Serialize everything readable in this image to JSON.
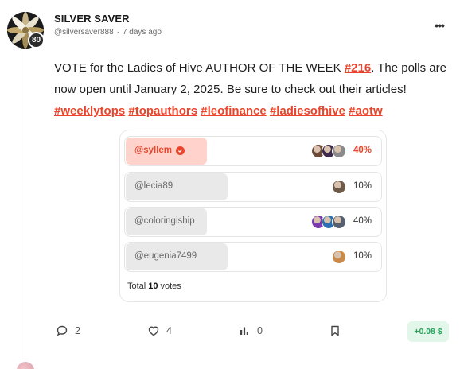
{
  "author": {
    "name": "SILVER SAVER",
    "handle": "@silversaver888",
    "separator": "·",
    "time_ago": "7 days ago",
    "reputation": "80"
  },
  "more_label": "•••",
  "post": {
    "text_intro": "VOTE for the Ladies of Hive AUTHOR OF THE WEEK ",
    "issue_tag": "#216",
    "text_rest": ". The polls are now open until January 2, 2025. Be sure to check out their articles! ",
    "hashtags": [
      "#weeklytops",
      "#topauthors",
      "#leofinance",
      "#ladiesofhive",
      "#aotw"
    ]
  },
  "poll": {
    "options": [
      {
        "label": "@syllem",
        "percent": "40%",
        "fill_fraction": 0.4,
        "winner": true,
        "voters": [
          "#6b4a3a",
          "#3d2a4d",
          "#8a8a8a"
        ]
      },
      {
        "label": "@lecia89",
        "percent": "10%",
        "fill_fraction": 0.0,
        "winner": false,
        "voters": [
          "#6e5a48"
        ]
      },
      {
        "label": "@coloringiship",
        "percent": "40%",
        "fill_fraction": 0.4,
        "winner": false,
        "voters": [
          "#7a3bb0",
          "#2a6fb3",
          "#556070"
        ]
      },
      {
        "label": "@eugenia7499",
        "percent": "10%",
        "fill_fraction": 0.0,
        "winner": false,
        "voters": [
          "#c98a4a"
        ]
      }
    ],
    "total_prefix": "Total",
    "total_count": "10",
    "total_suffix": "votes",
    "colors": {
      "winner_fill": "#ffd3cc",
      "other_fill": "#e9e9e9",
      "accent": "#e8452c"
    }
  },
  "actions": {
    "comments": "2",
    "likes": "4",
    "views": "0",
    "payout": "+0.08 $"
  }
}
